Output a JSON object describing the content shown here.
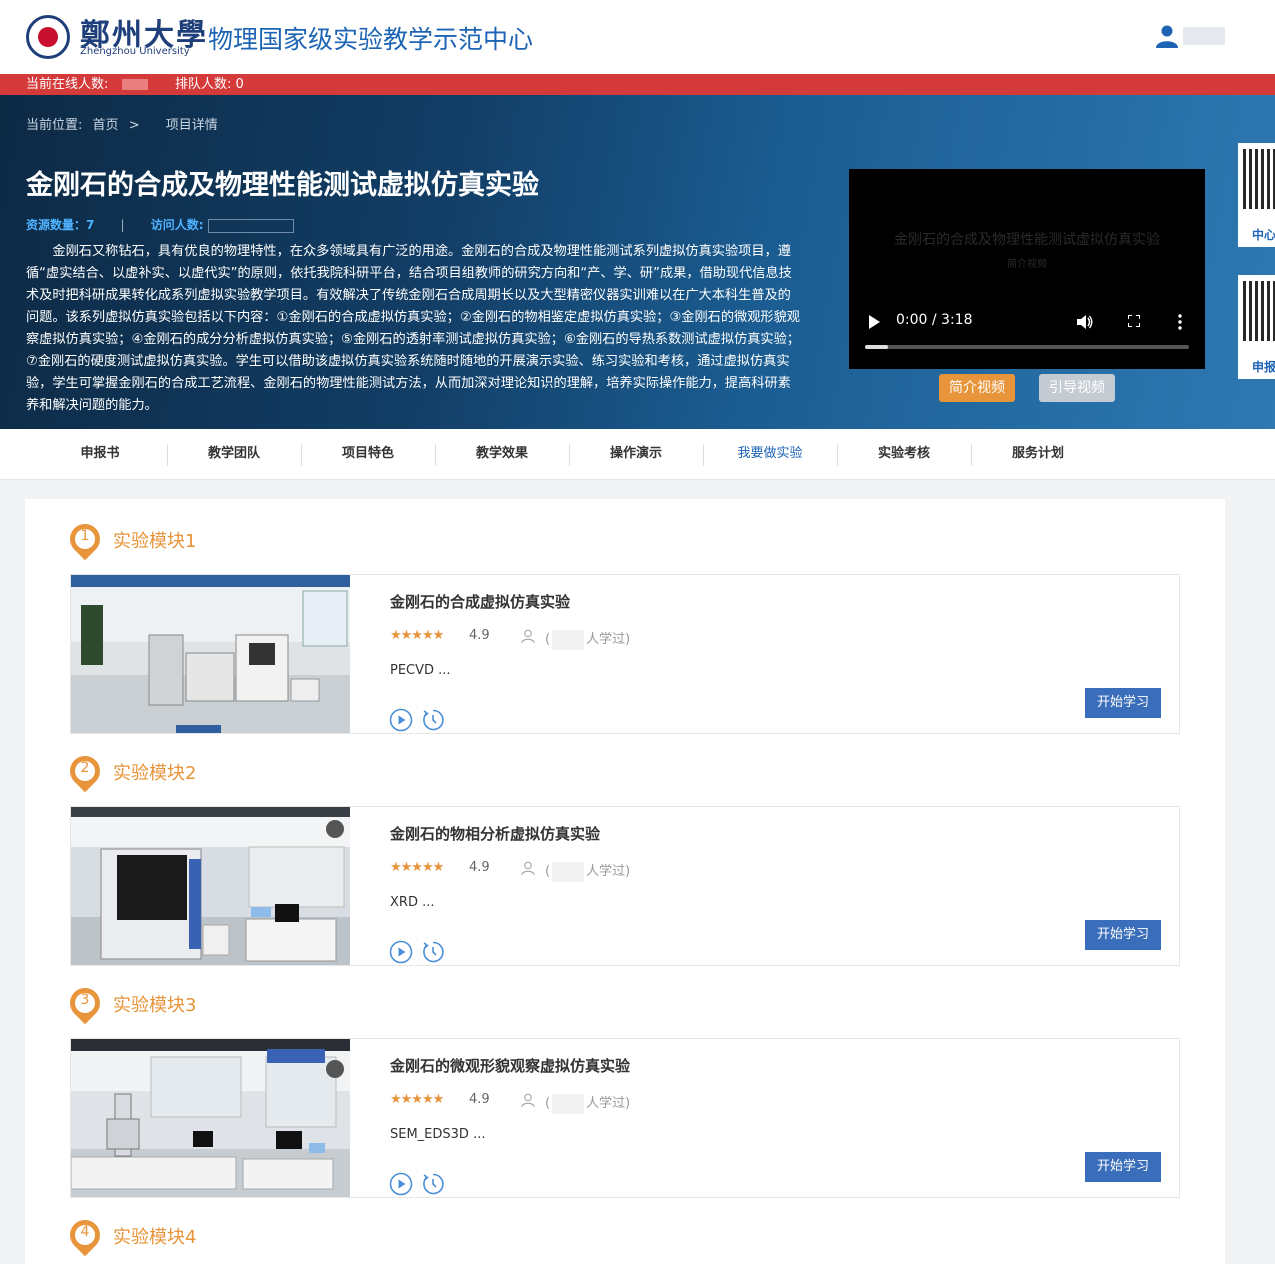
{
  "header": {
    "logo_cn": "鄭州大學",
    "logo_en": "Zhengzhou University",
    "site_title": "物理国家级实验教学示范中心"
  },
  "status_bar": {
    "online_label": "当前在线人数:",
    "queue_label": "排队人数: 0"
  },
  "breadcrumb": {
    "prefix": "当前位置:",
    "home": "首页",
    "sep": ">",
    "current": "项目详情"
  },
  "project": {
    "title": "金刚石的合成及物理性能测试虚拟仿真实验",
    "resources": "资源数量：7",
    "sep": "|",
    "visits_label": "访问人数:",
    "description": "金刚石又称钻石，具有优良的物理特性，在众多领域具有广泛的用途。金刚石的合成及物理性能测试系列虚拟仿真实验项目，遵循“虚实结合、以虚补实、以虚代实”的原则，依托我院科研平台，结合项目组教师的研究方向和“产、学、研”成果，借助现代信息技术及时把科研成果转化成系列虚拟实验教学项目。有效解决了传统金刚石合成周期长以及大型精密仪器实训难以在广大本科生普及的问题。该系列虚拟仿真实验包括以下内容：①金刚石的合成虚拟仿真实验；②金刚石的物相鉴定虚拟仿真实验；③金刚石的微观形貌观察虚拟仿真实验；④金刚石的成分分析虚拟仿真实验；⑤金刚石的透射率测试虚拟仿真实验；⑥金刚石的导热系数测试虚拟仿真实验；⑦金刚石的硬度测试虚拟仿真实验。学生可以借助该虚拟仿真实验系统随时随地的开展演示实验、练习实验和考核，通过虚拟仿真实验，学生可掌握金刚石的合成工艺流程、金刚石的物理性能测试方法，从而加深对理论知识的理解，培养实际操作能力，提高科研素养和解决问题的能力。"
  },
  "video": {
    "overlay_title": "金刚石的合成及物理性能测试虚拟仿真实验",
    "overlay_sub": "简介视频",
    "time": "0:00 / 3:18",
    "progress": 0.07
  },
  "video_buttons": {
    "intro": "简介视频",
    "guide": "引导视频"
  },
  "qr": {
    "label1": "中心",
    "label2": "申报"
  },
  "tabs": [
    "申报书",
    "教学团队",
    "项目特色",
    "教学效果",
    "操作演示",
    "我要做实验",
    "实验考核",
    "服务计划"
  ],
  "active_tab": "我要做实验",
  "modules": [
    {
      "num": "1",
      "label": "实验模块1",
      "title": "金刚石的合成虚拟仿真实验",
      "stars": "★★★★★",
      "rating": "4.9",
      "learned_open": "(",
      "learned_close": "人学过)",
      "desc": "PECVD ...",
      "button": "开始学习"
    },
    {
      "num": "2",
      "label": "实验模块2",
      "title": "金刚石的物相分析虚拟仿真实验",
      "stars": "★★★★★",
      "rating": "4.9",
      "learned_open": "(",
      "learned_close": "人学过)",
      "desc": "XRD ...",
      "button": "开始学习"
    },
    {
      "num": "3",
      "label": "实验模块3",
      "title": "金刚石的微观形貌观察虚拟仿真实验",
      "stars": "★★★★★",
      "rating": "4.9",
      "learned_open": "(",
      "learned_close": "人学过)",
      "desc": "SEM_EDS3D ...",
      "button": "开始学习"
    },
    {
      "num": "4",
      "label": "实验模块4"
    }
  ],
  "icons": {
    "user": "user-icon",
    "play": "play-circle-icon",
    "clock": "clock-refresh-icon",
    "person": "person-outline-icon"
  },
  "colors": {
    "brand_blue": "#1e64b4",
    "status_red": "#d53a3a",
    "accent_orange": "#e8943a",
    "button_blue": "#3a6dba"
  }
}
